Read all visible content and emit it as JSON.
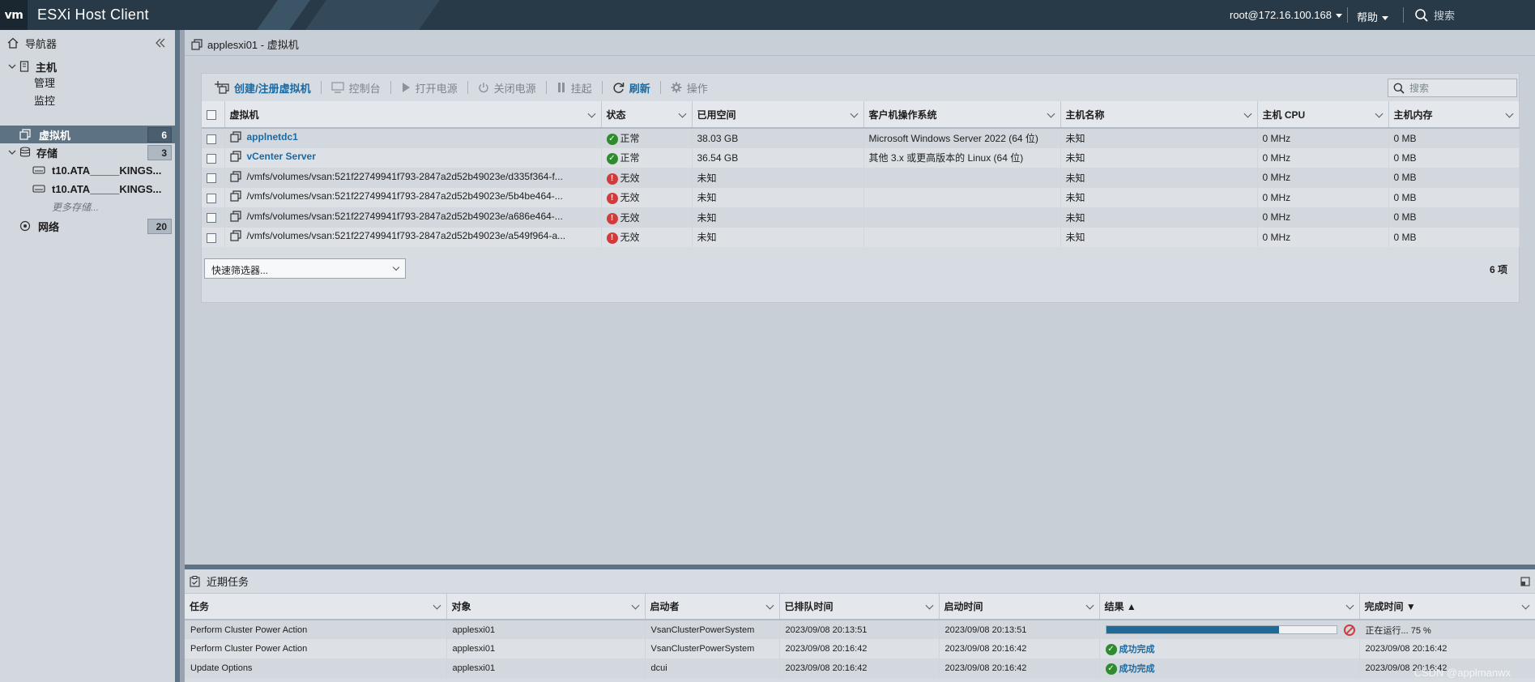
{
  "topbar": {
    "logo": "vm",
    "title": "ESXi Host Client",
    "user": "root@172.16.100.168",
    "help": "帮助",
    "search_placeholder": "搜索"
  },
  "navigator": {
    "title": "导航器",
    "host": "主机",
    "manage": "管理",
    "monitor": "监控",
    "vms": {
      "label": "虚拟机",
      "count": "6"
    },
    "storage": {
      "label": "存储",
      "count": "3"
    },
    "datastores": [
      "t10.ATA_____KINGS...",
      "t10.ATA_____KINGS..."
    ],
    "more_storage": "更多存储...",
    "network": {
      "label": "网络",
      "count": "20"
    }
  },
  "breadcrumb": "applesxi01 - 虚拟机",
  "toolbar": {
    "create": "创建/注册虚拟机",
    "console": "控制台",
    "power_on": "打开电源",
    "power_off": "关闭电源",
    "suspend": "挂起",
    "refresh": "刷新",
    "actions": "操作",
    "search_placeholder": "搜索"
  },
  "vm_table": {
    "columns": [
      "虚拟机",
      "状态",
      "已用空间",
      "客户机操作系统",
      "主机名称",
      "主机 CPU",
      "主机内存"
    ],
    "rows": [
      {
        "name": "applnetdc1",
        "status": "正常",
        "ok": true,
        "used": "38.03 GB",
        "os": "Microsoft Windows Server 2022 (64 位)",
        "hostname": "未知",
        "cpu": "0 MHz",
        "mem": "0 MB"
      },
      {
        "name": "vCenter Server",
        "status": "正常",
        "ok": true,
        "used": "36.54 GB",
        "os": "其他 3.x 或更高版本的 Linux (64 位)",
        "hostname": "未知",
        "cpu": "0 MHz",
        "mem": "0 MB"
      },
      {
        "name": "/vmfs/volumes/vsan:521f22749941f793-2847a2d52b49023e/d335f364-f...",
        "status": "无效",
        "ok": false,
        "used": "未知",
        "os": "",
        "hostname": "未知",
        "cpu": "0 MHz",
        "mem": "0 MB"
      },
      {
        "name": "/vmfs/volumes/vsan:521f22749941f793-2847a2d52b49023e/5b4be464-...",
        "status": "无效",
        "ok": false,
        "used": "未知",
        "os": "",
        "hostname": "未知",
        "cpu": "0 MHz",
        "mem": "0 MB"
      },
      {
        "name": "/vmfs/volumes/vsan:521f22749941f793-2847a2d52b49023e/a686e464-...",
        "status": "无效",
        "ok": false,
        "used": "未知",
        "os": "",
        "hostname": "未知",
        "cpu": "0 MHz",
        "mem": "0 MB"
      },
      {
        "name": "/vmfs/volumes/vsan:521f22749941f793-2847a2d52b49023e/a549f964-a...",
        "status": "无效",
        "ok": false,
        "used": "未知",
        "os": "",
        "hostname": "未知",
        "cpu": "0 MHz",
        "mem": "0 MB"
      }
    ],
    "quick_filter": "快速筛选器...",
    "count": "6 项"
  },
  "tasks": {
    "title": "近期任务",
    "columns": [
      "任务",
      "对象",
      "启动者",
      "已排队时间",
      "启动时间",
      "结果 ▲",
      "完成时间 ▼"
    ],
    "rows": [
      {
        "task": "Perform Cluster Power Action",
        "target": "applesxi01",
        "initiator": "VsanClusterPowerSystem",
        "queued": "2023/09/08 20:13:51",
        "started": "2023/09/08 20:13:51",
        "result": "",
        "progress": 0.75,
        "completed": "正在运行... 75 %"
      },
      {
        "task": "Perform Cluster Power Action",
        "target": "applesxi01",
        "initiator": "VsanClusterPowerSystem",
        "queued": "2023/09/08 20:16:42",
        "started": "2023/09/08 20:16:42",
        "result": "成功完成",
        "completed": "2023/09/08 20:16:42"
      },
      {
        "task": "Update Options",
        "target": "applesxi01",
        "initiator": "dcui",
        "queued": "2023/09/08 20:16:42",
        "started": "2023/09/08 20:16:42",
        "result": "成功完成",
        "completed": "2023/09/08 20:16:42"
      }
    ]
  },
  "watermark": "CSDN @applmanwx"
}
